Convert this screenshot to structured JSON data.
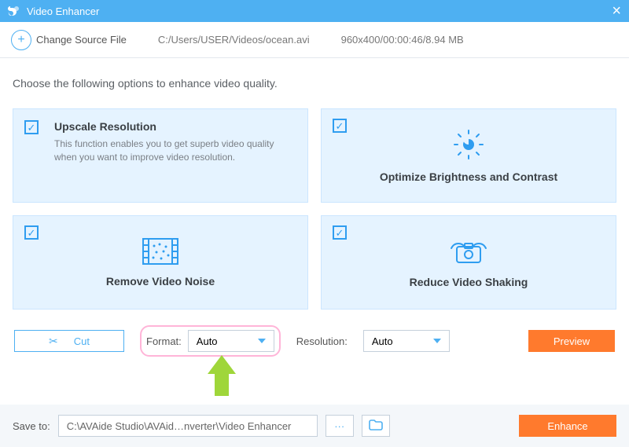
{
  "app": {
    "title": "Video Enhancer"
  },
  "source": {
    "change_label": "Change Source File",
    "path": "C:/Users/USER/Videos/ocean.avi",
    "info": "960x400/00:00:46/8.94 MB"
  },
  "intro": "Choose the following options to enhance video quality.",
  "cards": {
    "upscale": {
      "title": "Upscale Resolution",
      "desc": "This function enables you to get superb video quality when you want to improve video resolution."
    },
    "brightness": {
      "title": "Optimize Brightness and Contrast"
    },
    "noise": {
      "title": "Remove Video Noise"
    },
    "shaking": {
      "title": "Reduce Video Shaking"
    }
  },
  "controls": {
    "cut_label": "Cut",
    "format_label": "Format:",
    "format_value": "Auto",
    "resolution_label": "Resolution:",
    "resolution_value": "Auto",
    "preview_label": "Preview"
  },
  "bottom": {
    "save_to_label": "Save to:",
    "save_path": "C:\\AVAide Studio\\AVAid…nverter\\Video Enhancer",
    "more": "···",
    "enhance_label": "Enhance"
  }
}
